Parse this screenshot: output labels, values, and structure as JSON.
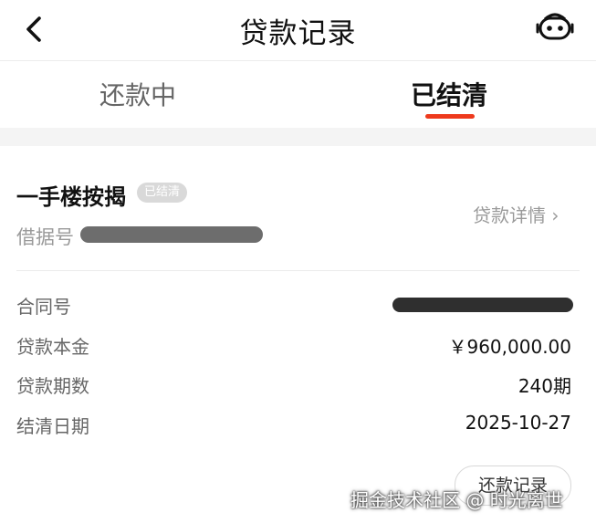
{
  "header": {
    "title": "贷款记录",
    "back_icon": "chevron-left-icon",
    "service_icon": "robot-service-icon"
  },
  "tabs": [
    {
      "label": "还款中",
      "active": false
    },
    {
      "label": "已结清",
      "active": true
    }
  ],
  "loan": {
    "name": "一手楼按揭",
    "status": "已结清",
    "receipt_label": "借据号",
    "detail_link": "贷款详情 ›",
    "rows": [
      {
        "label": "合同号",
        "value": ""
      },
      {
        "label": "贷款本金",
        "value": "￥960,000.00"
      },
      {
        "label": "贷款期数",
        "value": "240期"
      },
      {
        "label": "结清日期",
        "value": "2025-10-27"
      }
    ],
    "record_button": "还款记录"
  },
  "watermark": "掘金技术社区 @ 时光离世",
  "colors": {
    "accent": "#ee3a1d",
    "badge_bg": "#d9d9d9",
    "muted_text": "#9a9a9a"
  }
}
